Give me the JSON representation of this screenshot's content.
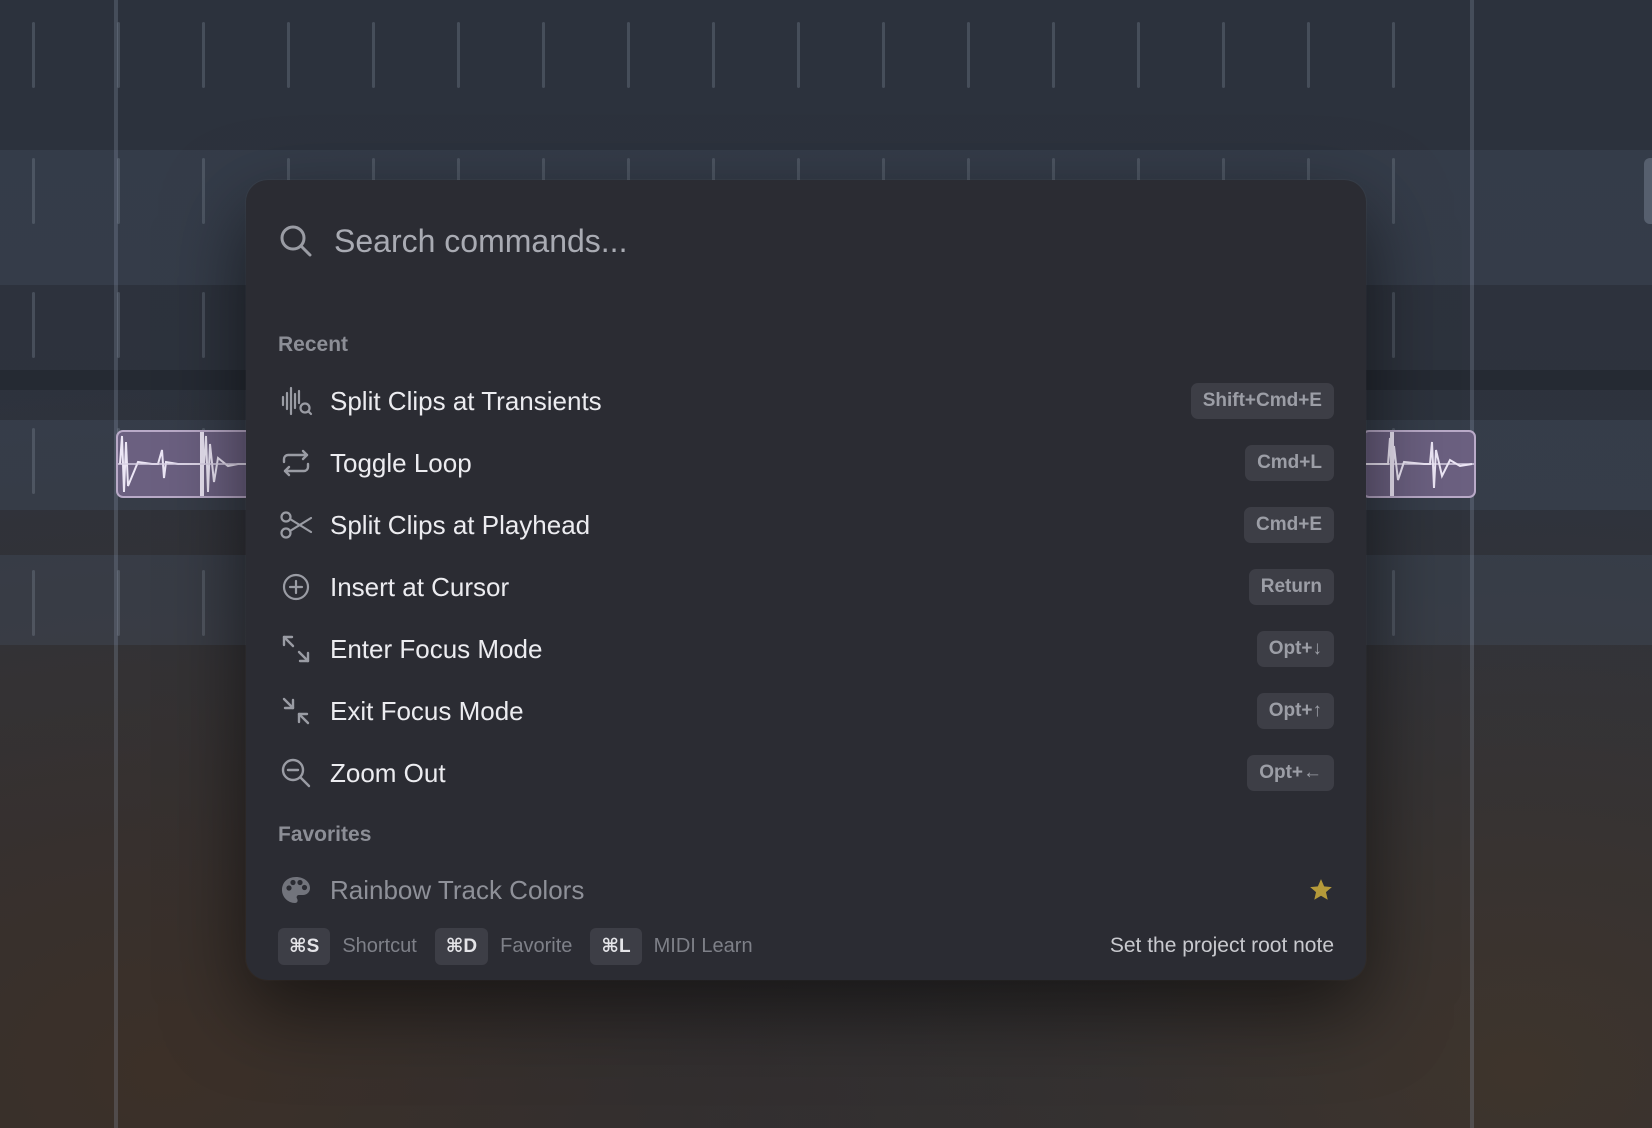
{
  "search": {
    "placeholder": "Search commands..."
  },
  "sections": {
    "recent_label": "Recent",
    "favorites_label": "Favorites"
  },
  "recent": [
    {
      "label": "Split Clips at Transients",
      "shortcut": "Shift+Cmd+E",
      "icon": "waveform-search-icon"
    },
    {
      "label": "Toggle Loop",
      "shortcut": "Cmd+L",
      "icon": "loop-icon"
    },
    {
      "label": "Split Clips at Playhead",
      "shortcut": "Cmd+E",
      "icon": "scissors-icon"
    },
    {
      "label": "Insert at Cursor",
      "shortcut": "Return",
      "icon": "plus-circle-icon"
    },
    {
      "label": "Enter Focus Mode",
      "shortcut": "Opt+↓",
      "icon": "expand-icon"
    },
    {
      "label": "Exit Focus Mode",
      "shortcut": "Opt+↑",
      "icon": "collapse-icon"
    },
    {
      "label": "Zoom Out",
      "shortcut": "Opt+←",
      "icon": "zoom-out-icon"
    }
  ],
  "favorites": [
    {
      "label": "Rainbow Track Colors",
      "icon": "palette-icon",
      "badge": "star-icon"
    }
  ],
  "footer": {
    "hints": [
      {
        "key": "⌘S",
        "text": "Shortcut"
      },
      {
        "key": "⌘D",
        "text": "Favorite"
      },
      {
        "key": "⌘L",
        "text": "MIDI Learn"
      }
    ],
    "description": "Set the project root note"
  },
  "colors": {
    "accent_star": "#b59a3a",
    "clip_fill": "#6b6080",
    "clip_border": "#b9aac8"
  }
}
